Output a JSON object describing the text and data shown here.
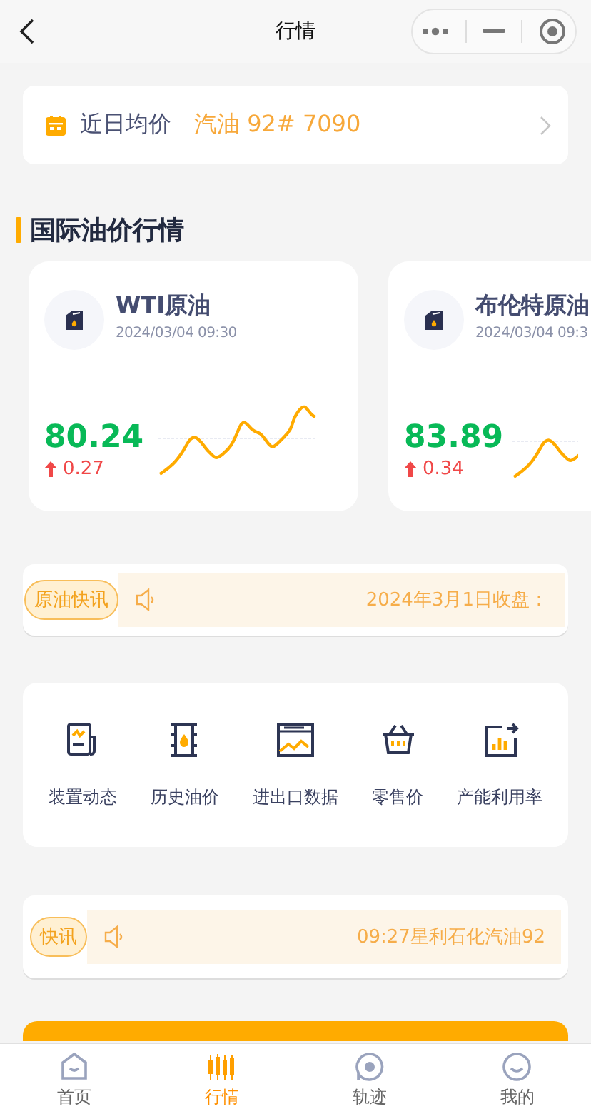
{
  "header": {
    "title": "行情"
  },
  "average_price": {
    "label": "近日均价",
    "value": "汽油 92# 7090"
  },
  "section": {
    "title": "国际油价行情"
  },
  "quotes": [
    {
      "name": "WTI原油",
      "time": "2024/03/04 09:30",
      "price": "80.24",
      "change": "0.27"
    },
    {
      "name": "布伦特原油",
      "time": "2024/03/04 09:3",
      "price": "83.89",
      "change": "0.34"
    }
  ],
  "tickers": [
    {
      "tag": "原油快讯",
      "text": "2024年3月1日收盘："
    },
    {
      "tag": "快讯",
      "text": "09:27星利石化汽油92"
    }
  ],
  "shortcuts": [
    {
      "label": "装置动态",
      "kind": "report"
    },
    {
      "label": "历史油价",
      "kind": "barrel"
    },
    {
      "label": "进出口数据",
      "kind": "screen"
    },
    {
      "label": "零售价",
      "kind": "basket"
    },
    {
      "label": "产能利用率",
      "kind": "export"
    }
  ],
  "tab_bar": [
    {
      "label": "首页",
      "kind": "home",
      "selected": false
    },
    {
      "label": "行情",
      "kind": "market",
      "selected": true
    },
    {
      "label": "轨迹",
      "kind": "track",
      "selected": false
    },
    {
      "label": "我的",
      "kind": "me",
      "selected": false
    }
  ]
}
